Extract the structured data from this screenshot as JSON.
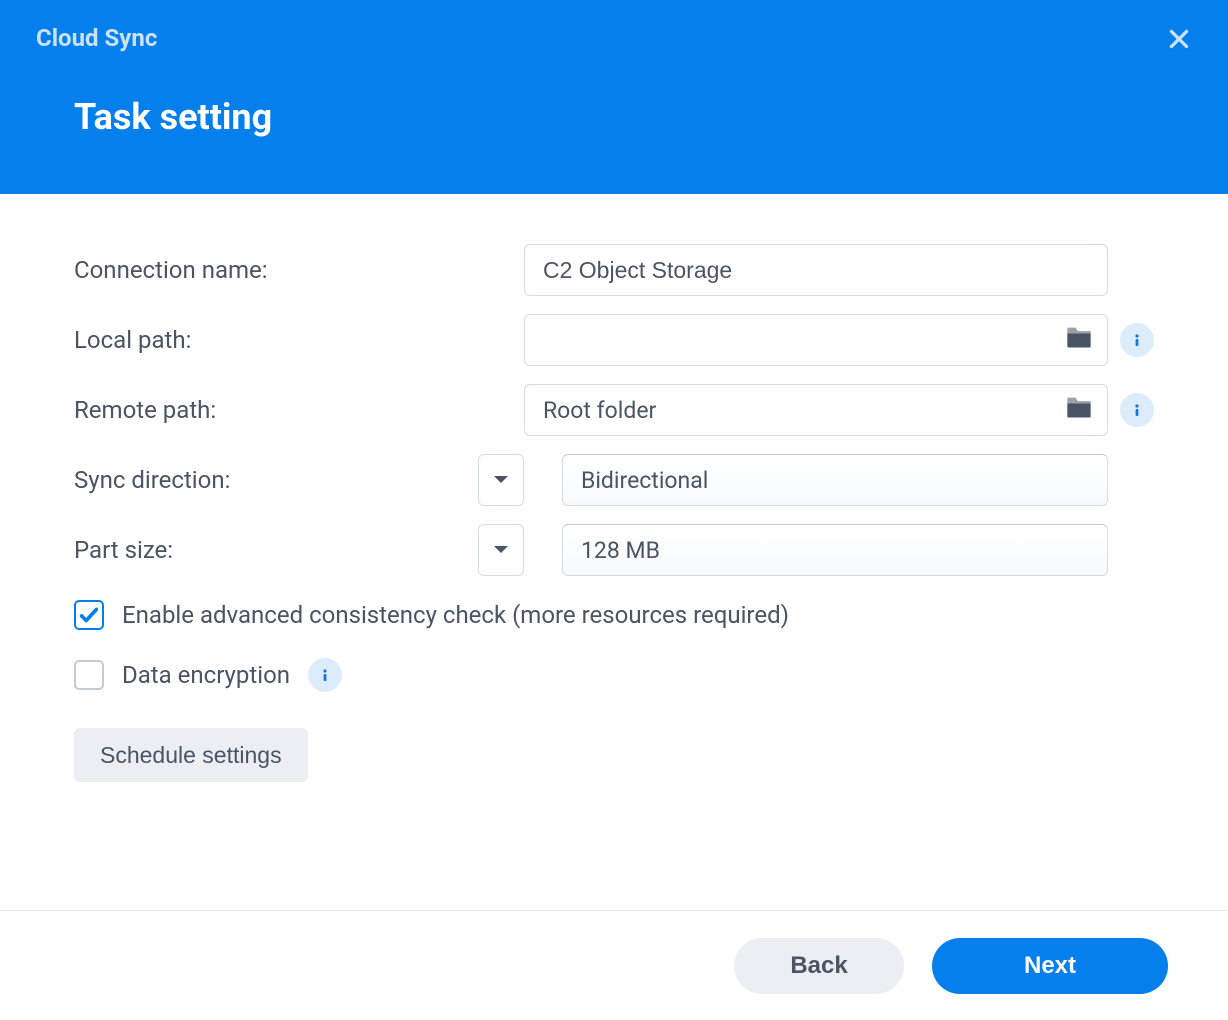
{
  "app_title": "Cloud Sync",
  "page_title": "Task setting",
  "labels": {
    "connection_name": "Connection name:",
    "local_path": "Local path:",
    "remote_path": "Remote path:",
    "sync_direction": "Sync direction:",
    "part_size": "Part size:"
  },
  "fields": {
    "connection_name": "C2 Object Storage",
    "local_path": "",
    "remote_path": "Root folder",
    "sync_direction": "Bidirectional",
    "part_size": "128 MB"
  },
  "checkboxes": {
    "consistency_label": "Enable advanced consistency check (more resources required)",
    "consistency_checked": true,
    "encryption_label": "Data encryption",
    "encryption_checked": false
  },
  "buttons": {
    "schedule": "Schedule settings",
    "back": "Back",
    "next": "Next"
  }
}
